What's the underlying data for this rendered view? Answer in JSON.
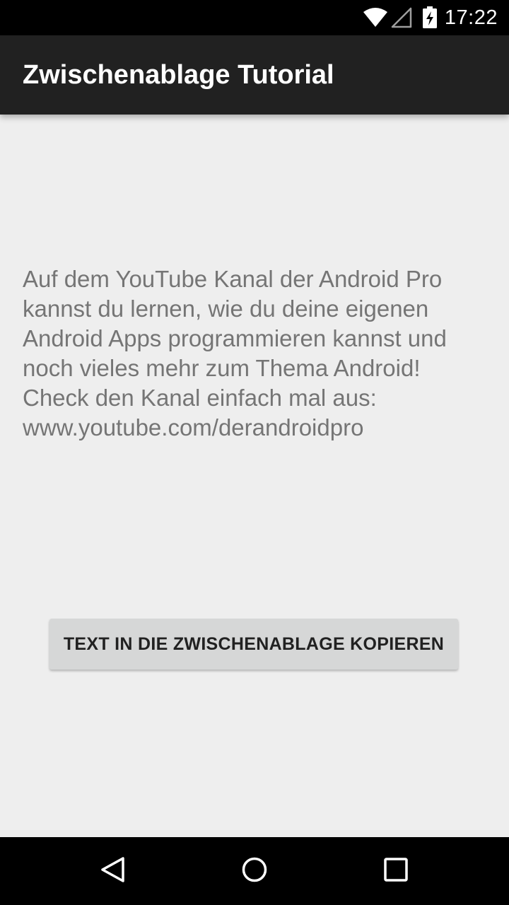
{
  "status_bar": {
    "time": "17:22",
    "icons": [
      "wifi-icon",
      "cell-signal-icon",
      "battery-charging-icon"
    ]
  },
  "app_bar": {
    "title": "Zwischenablage Tutorial",
    "background": "#212121"
  },
  "main": {
    "body_text": "Auf dem YouTube Kanal der Android Pro kannst du lernen, wie du deine eigenen Android Apps programmieren kannst und noch vieles mehr zum Thema Android! Check den Kanal einfach mal aus: www.youtube.com/derandroidpro",
    "copy_button_label": "TEXT IN DIE ZWISCHENABLAGE KOPIEREN"
  },
  "nav_bar": {
    "icons": [
      "back-icon",
      "home-icon",
      "recents-icon"
    ]
  },
  "colors": {
    "content_background": "#eeeeee",
    "body_text": "#757575",
    "button_background": "#d6d7d7"
  }
}
